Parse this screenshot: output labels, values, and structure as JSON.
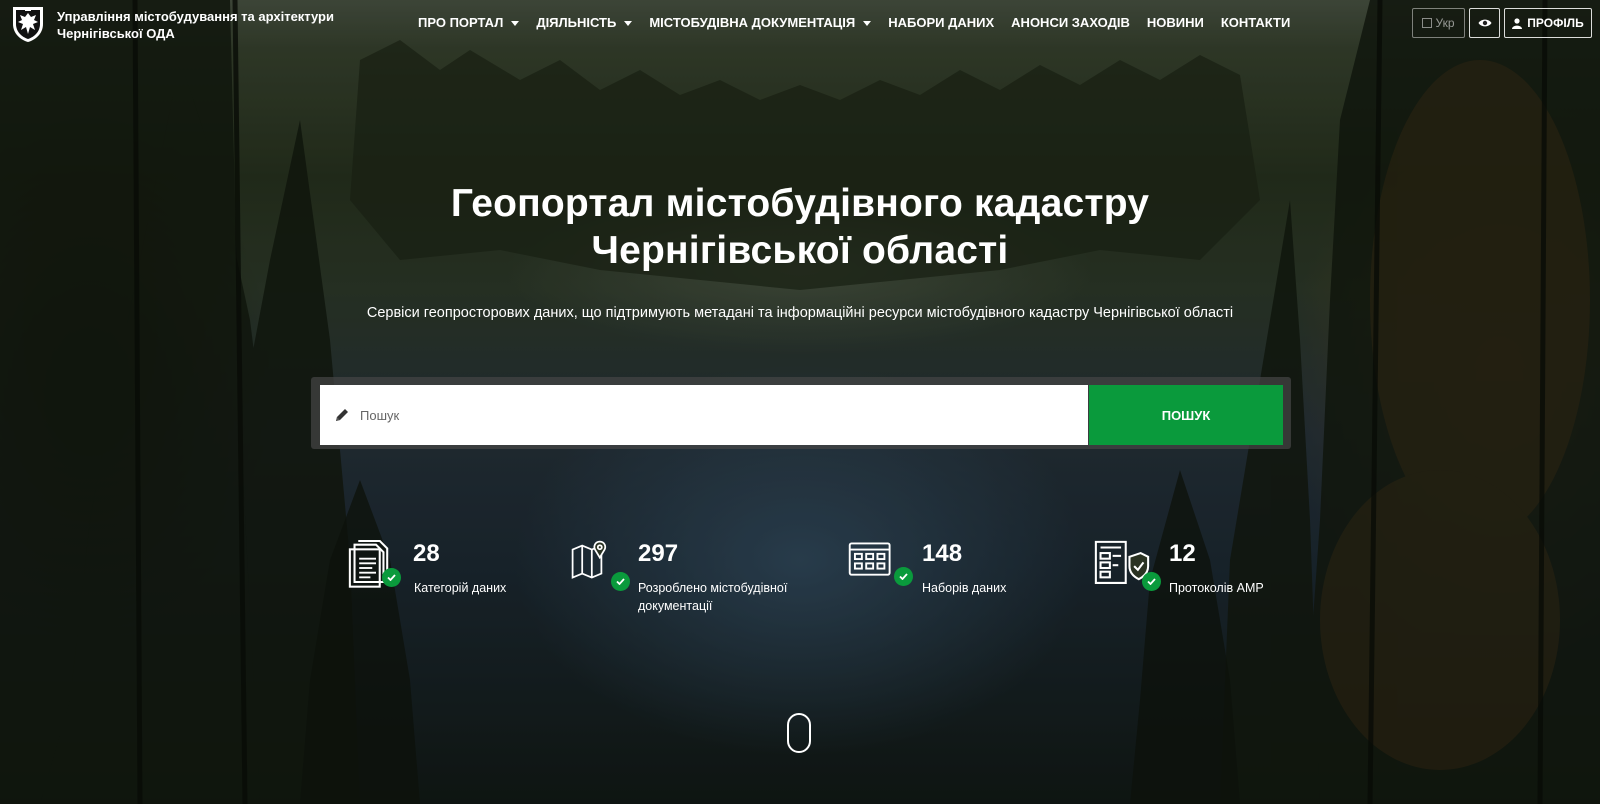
{
  "header": {
    "brand_line1": "Управління містобудування та архітектури",
    "brand_line2": "Чернігівської ОДА",
    "nav": [
      {
        "label": "ПРО ПОРТАЛ",
        "dropdown": true
      },
      {
        "label": "ДІЯЛЬНІСТЬ",
        "dropdown": true
      },
      {
        "label": "МІСТОБУДІВНА ДОКУМЕНТАЦІЯ",
        "dropdown": true
      },
      {
        "label": "НАБОРИ ДАНИХ",
        "dropdown": false
      },
      {
        "label": "АНОНСИ ЗАХОДІВ",
        "dropdown": false
      },
      {
        "label": "НОВИНИ",
        "dropdown": false
      },
      {
        "label": "КОНТАКТИ",
        "dropdown": false
      }
    ],
    "lang_label": "Укр",
    "profile_label": "ПРОФІЛЬ"
  },
  "hero": {
    "title_line1": "Геопортал містобудівного кадастру",
    "title_line2": "Чернігівської області",
    "subtitle": "Сервіси геопросторових даних, що підтримують метадані та інформаційні ресурси містобудівного кадастру Чернігівської області"
  },
  "search": {
    "placeholder": "Пошук",
    "button_label": "ПОШУК"
  },
  "stats": [
    {
      "icon": "documents-icon",
      "number": "28",
      "label_line1": "Категорій даних",
      "label_line2": ""
    },
    {
      "icon": "map-pin-icon",
      "number": "297",
      "label_line1": "Розроблено містобудівної",
      "label_line2": "документації"
    },
    {
      "icon": "calendar-grid-icon",
      "number": "148",
      "label_line1": "Наборів даних",
      "label_line2": ""
    },
    {
      "icon": "protocol-shield-icon",
      "number": "12",
      "label_line1": "Протоколів АМР",
      "label_line2": ""
    }
  ],
  "colors": {
    "accent_green": "#0a9a3c",
    "text": "#ffffff"
  }
}
